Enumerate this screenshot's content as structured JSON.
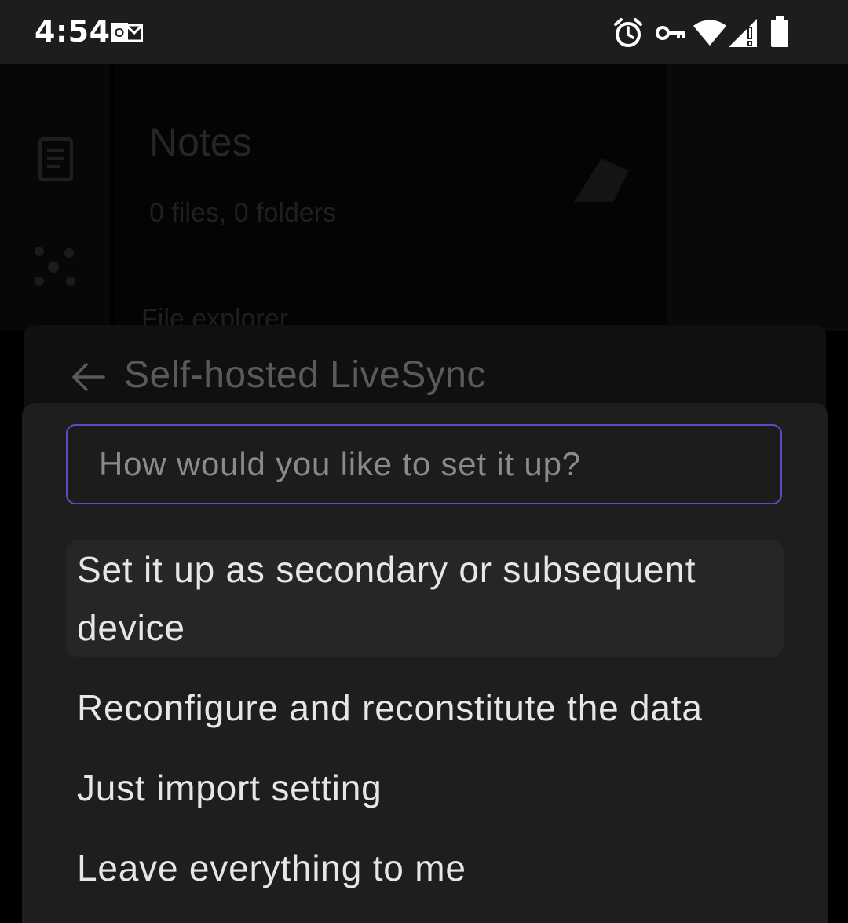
{
  "status_bar": {
    "time": "4:54",
    "left_icons": [
      "outlook-notification-icon"
    ],
    "right_icons": [
      "alarm-icon",
      "vpn-key-icon",
      "wifi-icon",
      "signal-icon",
      "battery-icon"
    ]
  },
  "background_app": {
    "title": "Notes",
    "subtitle": "0 files, 0 folders",
    "file_explorer_label": "File explorer"
  },
  "settings_modal": {
    "heading": "Self-hosted LiveSync"
  },
  "prompt": {
    "placeholder": "How would you like to set it up?",
    "value": "",
    "suggestions": [
      {
        "label": "Set it up as secondary or subsequent device",
        "selected": true
      },
      {
        "label": "Reconfigure and reconstitute the data",
        "selected": false
      },
      {
        "label": "Just import setting",
        "selected": false
      },
      {
        "label": "Leave everything to me",
        "selected": false
      }
    ]
  },
  "colors": {
    "accent": "#5b4cc4",
    "prompt_bg": "#1e1e1e",
    "selected_bg": "#262626",
    "text": "#e6e6e6"
  }
}
